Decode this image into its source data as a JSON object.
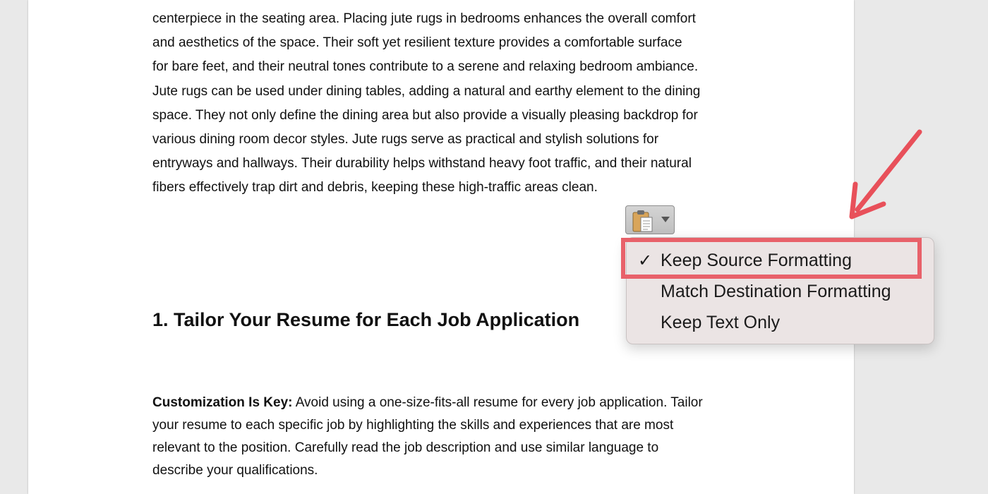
{
  "document": {
    "paragraph1_lines": [
      "centerpiece in the seating area. Placing jute rugs in bedrooms enhances the overall comfort",
      "and aesthetics of the space. Their soft yet resilient texture provides a comfortable surface",
      "for bare feet, and their neutral tones contribute to a serene and relaxing bedroom ambiance.",
      "Jute rugs can be used under dining tables, adding a natural and earthy element to the dining",
      "space. They not only define the dining area but also provide a visually pleasing backdrop for",
      "various dining room decor styles. Jute rugs serve as practical and stylish solutions for",
      "entryways and hallways. Their durability helps withstand heavy foot traffic, and their natural",
      "fibers effectively trap dirt and debris, keeping these high-traffic areas clean."
    ],
    "heading": "1. Tailor Your Resume for Each Job Application",
    "paragraph2": {
      "bold_lead": "Customization Is Key:",
      "line1_rest": " Avoid using a one-size-fits-all resume for every job application. Tailor",
      "lines": [
        "your resume to each specific job by highlighting the skills and experiences that are most",
        "relevant to the position. Carefully read the job description and use similar language to",
        "describe your qualifications."
      ]
    }
  },
  "paste_options": {
    "button_icon": "clipboard-icon",
    "dropdown_icon": "chevron-down-icon",
    "menu_items": [
      {
        "label": "Keep Source Formatting",
        "checked": true
      },
      {
        "label": "Match Destination Formatting",
        "checked": false
      },
      {
        "label": "Keep Text Only",
        "checked": false
      }
    ],
    "check_glyph": "✓"
  },
  "annotation": {
    "color": "#e8616a"
  }
}
